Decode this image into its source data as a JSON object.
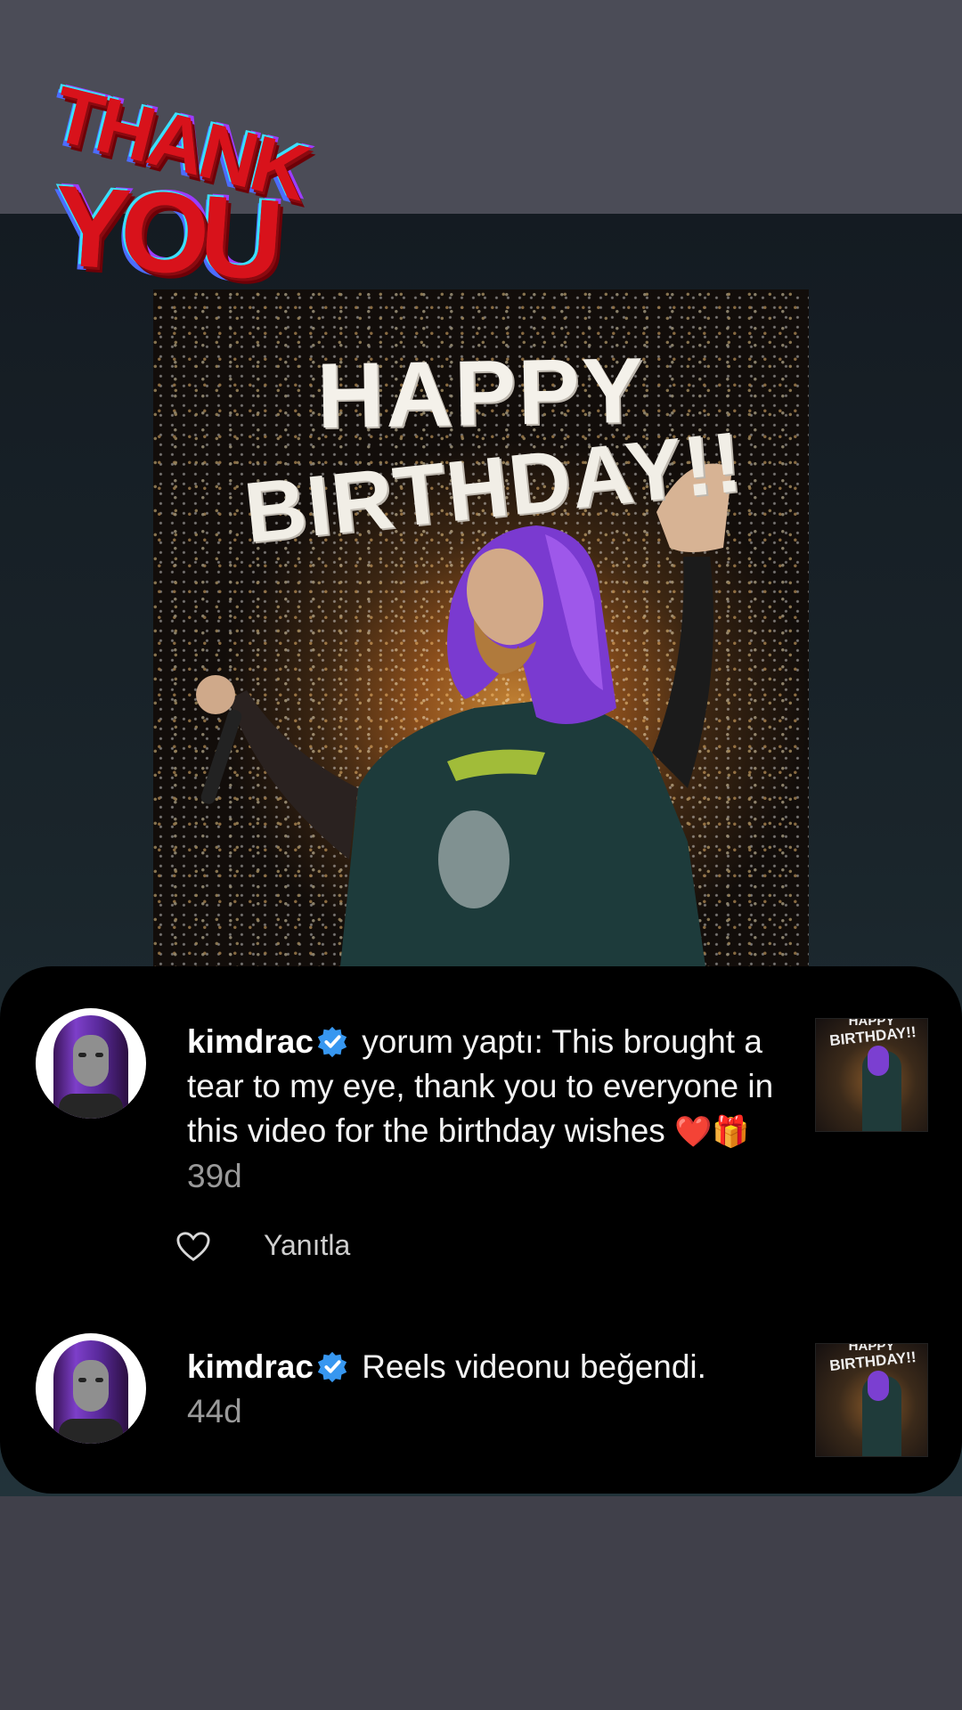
{
  "sticker": {
    "line1": "THANK",
    "line2": "YOU"
  },
  "poster": {
    "line1": "HAPPY",
    "line2": "BIRTHDAY!!"
  },
  "notifications": [
    {
      "username": "kimdrac",
      "action_text": " yorum yaptı: This brought a tear to my eye, thank you to everyone in this video for the birthday wishes ",
      "emojis": "❤️🎁",
      "time": " 39d",
      "reply_label": "Yanıtla",
      "thumbnail_line1": "HAPPY",
      "thumbnail_line2": "BIRTHDAY!!"
    },
    {
      "username": "kimdrac",
      "action_text": " Reels videonu beğendi.",
      "time": "44d",
      "thumbnail_line1": "HAPPY",
      "thumbnail_line2": "BIRTHDAY!!"
    }
  ],
  "colors": {
    "verified": "#3797f0",
    "card": "#000000"
  }
}
